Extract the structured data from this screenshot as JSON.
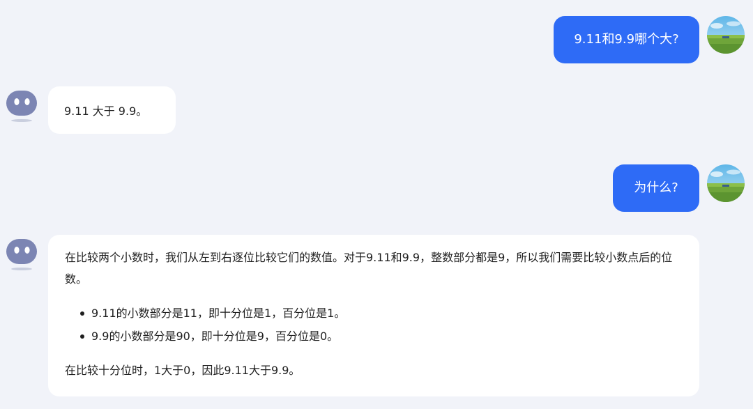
{
  "messages": [
    {
      "role": "user",
      "text": "9.11和9.9哪个大?"
    },
    {
      "role": "assistant",
      "text": "9.11 大于 9.9。"
    },
    {
      "role": "user",
      "text": "为什么?"
    },
    {
      "role": "assistant",
      "intro": "在比较两个小数时，我们从左到右逐位比较它们的数值。对于9.11和9.9，整数部分都是9，所以我们需要比较小数点后的位数。",
      "bullets": [
        "9.11的小数部分是11，即十分位是1，百分位是1。",
        "9.9的小数部分是90，即十分位是9，百分位是0。"
      ],
      "conclusion": "在比较十分位时，1大于0，因此9.11大于9.9。"
    }
  ],
  "colors": {
    "background": "#f1f3f9",
    "user_bubble": "#2e6bf6",
    "assistant_bubble": "#ffffff",
    "bot_avatar": "#7c85b3"
  },
  "icons": {
    "user_avatar": "landscape-avatar-icon",
    "assistant_avatar": "robot-face-icon"
  }
}
